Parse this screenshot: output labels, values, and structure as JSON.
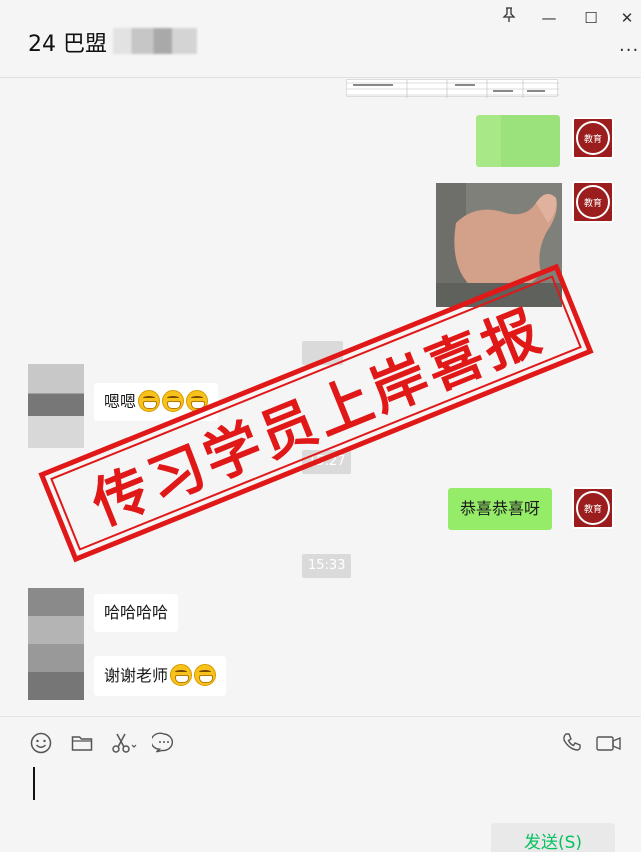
{
  "header": {
    "title": "24 巴盟",
    "more_label": "···"
  },
  "window_controls": {
    "pin": "pin-icon",
    "minimize": "—",
    "maximize": "☐",
    "close": "✕"
  },
  "avatar_me": {
    "line1": "教育"
  },
  "messages": [
    {
      "time": "15:27"
    },
    {
      "text_left_1": "嗯嗯"
    },
    {
      "text_right": "恭喜恭喜呀"
    },
    {
      "time": "15:33"
    },
    {
      "text_left_2": "哈哈哈哈"
    },
    {
      "text_left_3": "谢谢老师"
    }
  ],
  "stamp": {
    "text": "传习学员上岸喜报"
  },
  "composer": {
    "send_label": "发送(S)"
  },
  "colors": {
    "sent_bubble": "#95ec69",
    "stamp_red": "#e01818",
    "send_text": "#07c160"
  }
}
